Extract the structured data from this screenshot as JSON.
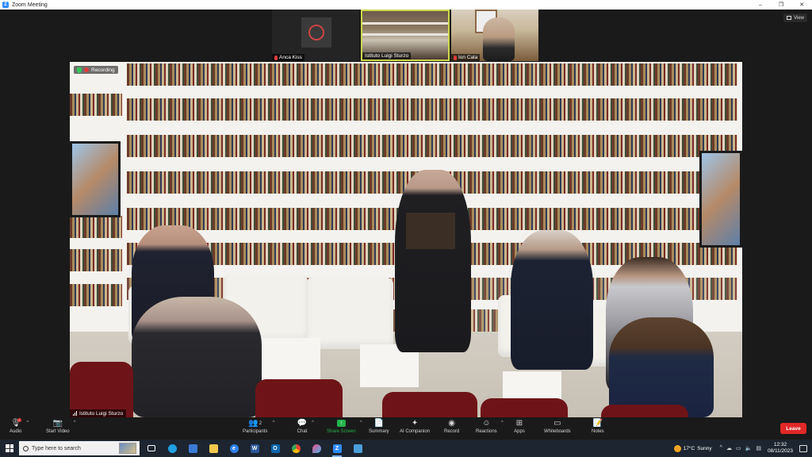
{
  "window": {
    "title": "Zoom Meeting",
    "minimize": "–",
    "maximize": "❐",
    "close": "✕"
  },
  "view_button": {
    "label": "View"
  },
  "thumbnails": [
    {
      "name": "Anca Kiss",
      "muted": true
    },
    {
      "name": "Istituto Luigi Sturzo",
      "muted": false,
      "active_speaker": true
    },
    {
      "name": "Ion Cala",
      "muted": true
    }
  ],
  "main_video": {
    "recording_label": "Recording",
    "participant_label": "Istituto Luigi Sturzo"
  },
  "toolbar": {
    "audio": "Audio",
    "start_video": "Start Video",
    "participants": "Participants",
    "participants_count": "2",
    "chat": "Chat",
    "share_screen": "Share Screen",
    "summary": "Summary",
    "ai_companion": "AI Companion",
    "record": "Record",
    "reactions": "Reactions",
    "apps": "Apps",
    "whiteboards": "Whiteboards",
    "notes": "Notes",
    "leave": "Leave"
  },
  "taskbar": {
    "search_placeholder": "Type here to search",
    "weather_temp": "17°C",
    "weather_text": "Sunny",
    "time": "12:32",
    "date": "08/11/2023"
  },
  "colors": {
    "accent_green": "#24b24b",
    "leave_red": "#e02828",
    "zoom_blue": "#2d8cff",
    "active_speaker_border": "#cfd84c"
  }
}
